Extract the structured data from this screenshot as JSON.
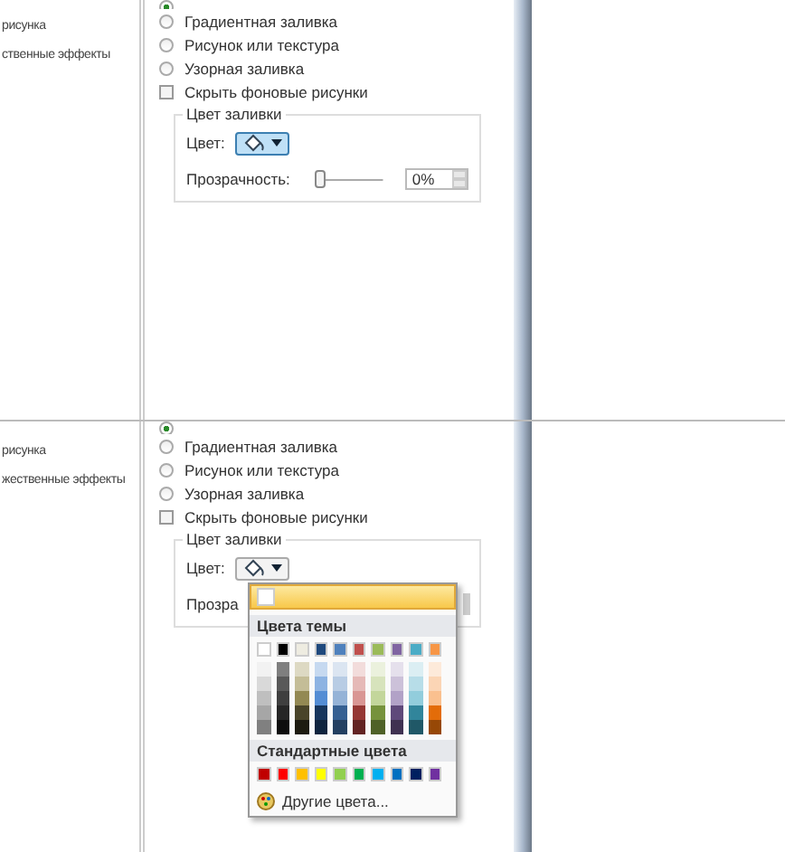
{
  "panels": [
    {
      "sidebar": {
        "items": [
          "рисунка",
          "ственные эффекты"
        ]
      },
      "top_radio": {
        "selected": true
      },
      "fill_options": [
        {
          "kind": "radio",
          "label": "Градиентная заливка",
          "selected": false
        },
        {
          "kind": "radio",
          "label": "Рисунок или текстура",
          "selected": false
        },
        {
          "kind": "radio",
          "label": "Узорная заливка",
          "selected": false
        },
        {
          "kind": "checkbox",
          "label": "Скрыть фоновые рисунки",
          "checked": false
        }
      ],
      "fill_color": {
        "title": "Цвет заливки",
        "color_label": "Цвет:",
        "color_button_pressed": true,
        "transparency_label": "Прозрачность:",
        "transparency": {
          "level": 0
        },
        "transparency_value": "0%"
      }
    },
    {
      "sidebar": {
        "items": [
          "рисунка",
          "жественные эффекты"
        ]
      },
      "top_radio": {
        "selected": true
      },
      "fill_options": [
        {
          "kind": "radio",
          "label": "Градиентная заливка",
          "selected": false
        },
        {
          "kind": "radio",
          "label": "Рисунок или текстура",
          "selected": false
        },
        {
          "kind": "radio",
          "label": "Узорная заливка",
          "selected": false
        },
        {
          "kind": "checkbox",
          "label": "Скрыть фоновые рисунки",
          "checked": false
        }
      ],
      "fill_color": {
        "title": "Цвет заливки",
        "color_label": "Цвет:",
        "color_button_pressed": false,
        "transparency_label": "Прозра"
      },
      "color_menu": {
        "theme_title": "Цвета темы",
        "theme_colors": [
          {
            "color": "#ffffff",
            "shades": [
              {
                "color": "#f2f2f2"
              },
              {
                "color": "#d9d9d9"
              },
              {
                "color": "#bfbfbf"
              },
              {
                "color": "#a6a6a6"
              },
              {
                "color": "#808080"
              }
            ]
          },
          {
            "color": "#000000",
            "shades": [
              {
                "color": "#7f7f7f"
              },
              {
                "color": "#595959"
              },
              {
                "color": "#3f3f3f"
              },
              {
                "color": "#262626"
              },
              {
                "color": "#0d0d0d"
              }
            ]
          },
          {
            "color": "#eeece1",
            "shades": [
              {
                "color": "#ddd9c3"
              },
              {
                "color": "#c4bd97"
              },
              {
                "color": "#938953"
              },
              {
                "color": "#494429"
              },
              {
                "color": "#1d1b10"
              }
            ]
          },
          {
            "color": "#1f497d",
            "shades": [
              {
                "color": "#c6d9f0"
              },
              {
                "color": "#8db3e2"
              },
              {
                "color": "#548dd4"
              },
              {
                "color": "#17365d"
              },
              {
                "color": "#0f243e"
              }
            ]
          },
          {
            "color": "#4f81bd",
            "shades": [
              {
                "color": "#dbe5f1"
              },
              {
                "color": "#b8cce4"
              },
              {
                "color": "#95b3d7"
              },
              {
                "color": "#366092"
              },
              {
                "color": "#244061"
              }
            ]
          },
          {
            "color": "#c0504d",
            "shades": [
              {
                "color": "#f2dcdb"
              },
              {
                "color": "#e5b9b7"
              },
              {
                "color": "#d99694"
              },
              {
                "color": "#953734"
              },
              {
                "color": "#632423"
              }
            ]
          },
          {
            "color": "#9bbb59",
            "shades": [
              {
                "color": "#ebf1dd"
              },
              {
                "color": "#d7e3bc"
              },
              {
                "color": "#c3d69b"
              },
              {
                "color": "#76923c"
              },
              {
                "color": "#4f6128"
              }
            ]
          },
          {
            "color": "#8064a2",
            "shades": [
              {
                "color": "#e5e0ec"
              },
              {
                "color": "#ccc1d9"
              },
              {
                "color": "#b2a2c7"
              },
              {
                "color": "#5f497a"
              },
              {
                "color": "#3f3151"
              }
            ]
          },
          {
            "color": "#4bacc6",
            "shades": [
              {
                "color": "#dbeef3"
              },
              {
                "color": "#b7dde8"
              },
              {
                "color": "#92cddc"
              },
              {
                "color": "#31859b"
              },
              {
                "color": "#205867"
              }
            ]
          },
          {
            "color": "#f79646",
            "shades": [
              {
                "color": "#fdeada"
              },
              {
                "color": "#fbd5b5"
              },
              {
                "color": "#fac08f"
              },
              {
                "color": "#e36c09"
              },
              {
                "color": "#974806"
              }
            ]
          }
        ],
        "standard_title": "Стандартные цвета",
        "standard_colors": [
          {
            "color": "#c00000"
          },
          {
            "color": "#ff0000"
          },
          {
            "color": "#ffc000"
          },
          {
            "color": "#ffff00"
          },
          {
            "color": "#92d050"
          },
          {
            "color": "#00b050"
          },
          {
            "color": "#00b0f0"
          },
          {
            "color": "#0070c0"
          },
          {
            "color": "#002060"
          },
          {
            "color": "#7030a0"
          }
        ],
        "more_colors": "Другие цвета..."
      }
    }
  ]
}
